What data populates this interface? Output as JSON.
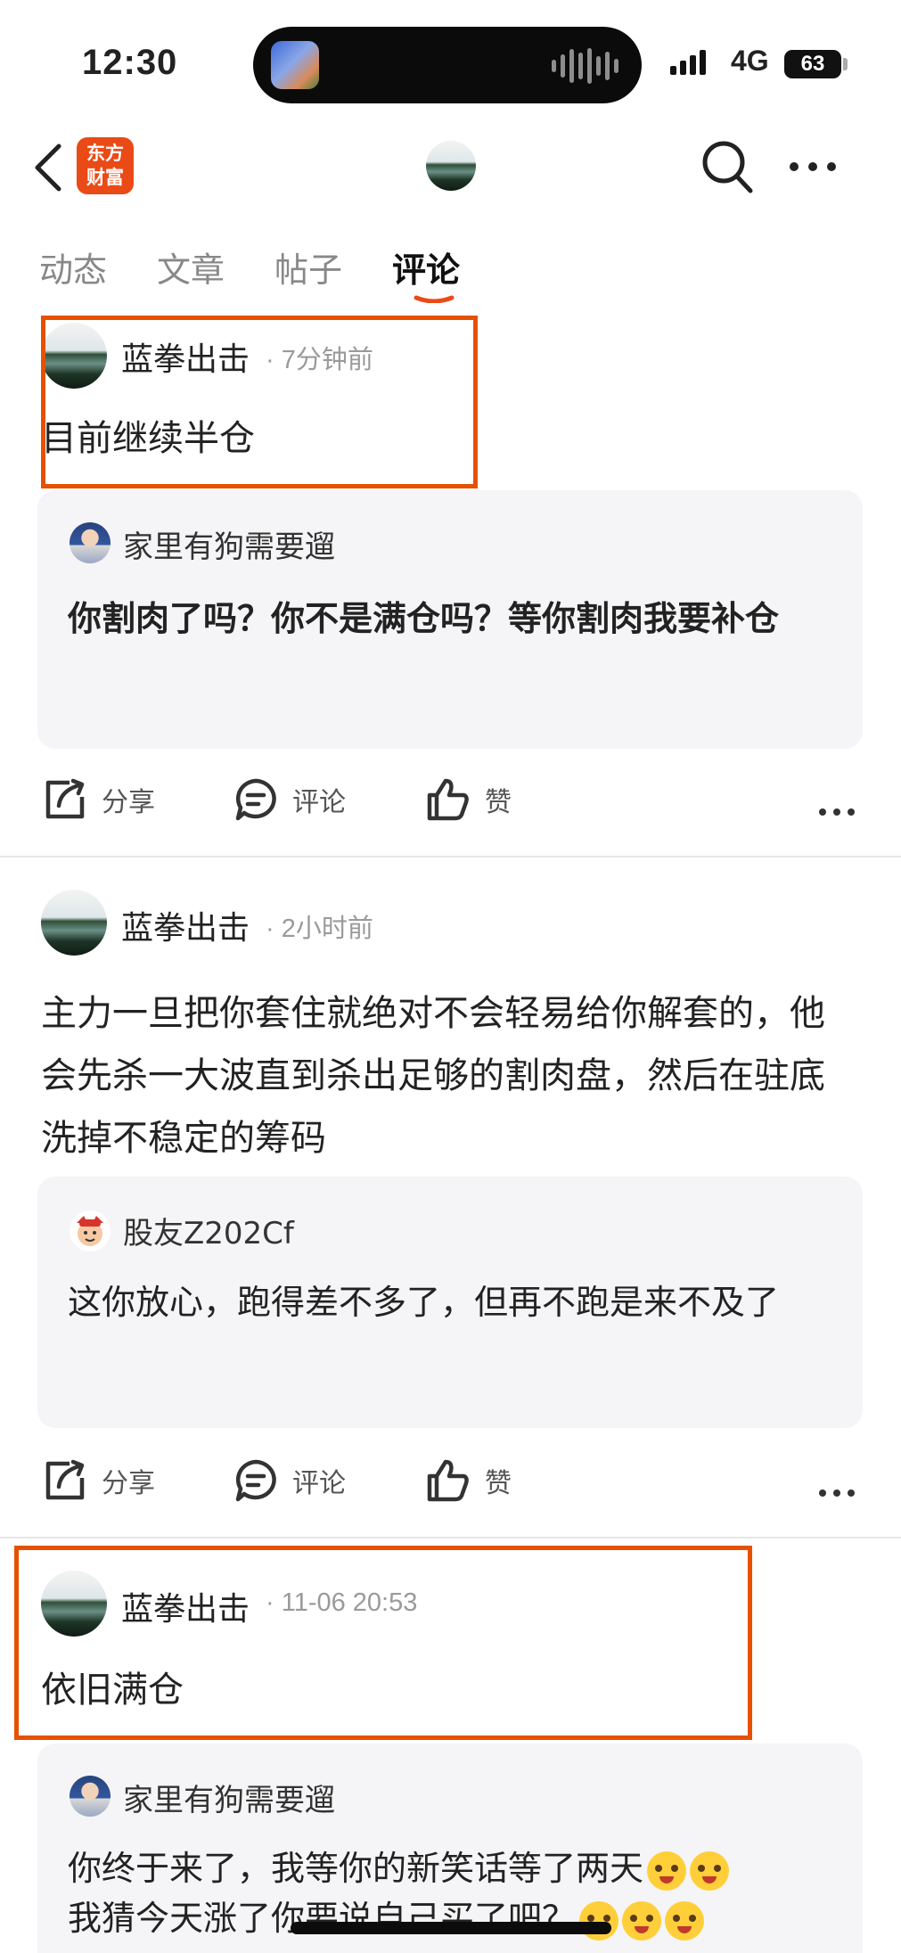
{
  "status_bar": {
    "time": "12:30",
    "network": "4G",
    "battery": "63"
  },
  "nav": {
    "logo_line1": "东方",
    "logo_line2": "财富",
    "tabs": [
      "动态",
      "文章",
      "帖子",
      "评论"
    ],
    "active_tab": "评论"
  },
  "posts": [
    {
      "author": "蓝拳出击",
      "time": "· 7分钟前",
      "text": "目前继续半仓",
      "reply": {
        "author": "家里有狗需要遛",
        "text": "你割肉了吗？你不是满仓吗？等你割肉我要补仓"
      },
      "actions": {
        "share": "分享",
        "comment": "评论",
        "like": "赞"
      }
    },
    {
      "author": "蓝拳出击",
      "time": "· 2小时前",
      "text": "主力一旦把你套住就绝对不会轻易给你解套的，他会先杀一大波直到杀出足够的割肉盘，然后在驻底洗掉不稳定的筹码",
      "reply": {
        "author": "股友Z202Cf",
        "text": "这你放心，跑得差不多了，但再不跑是来不及了"
      },
      "actions": {
        "share": "分享",
        "comment": "评论",
        "like": "赞"
      }
    },
    {
      "author": "蓝拳出击",
      "time": "· 11-06 20:53",
      "text": "依旧满仓",
      "reply": {
        "author": "家里有狗需要遛",
        "line1": "你终于来了，我等你的新笑话等了两天",
        "line2": "我猜今天涨了你要说自己买了吧？"
      }
    }
  ],
  "colors": {
    "accent": "#e65100",
    "logo": "#ea4a16"
  }
}
